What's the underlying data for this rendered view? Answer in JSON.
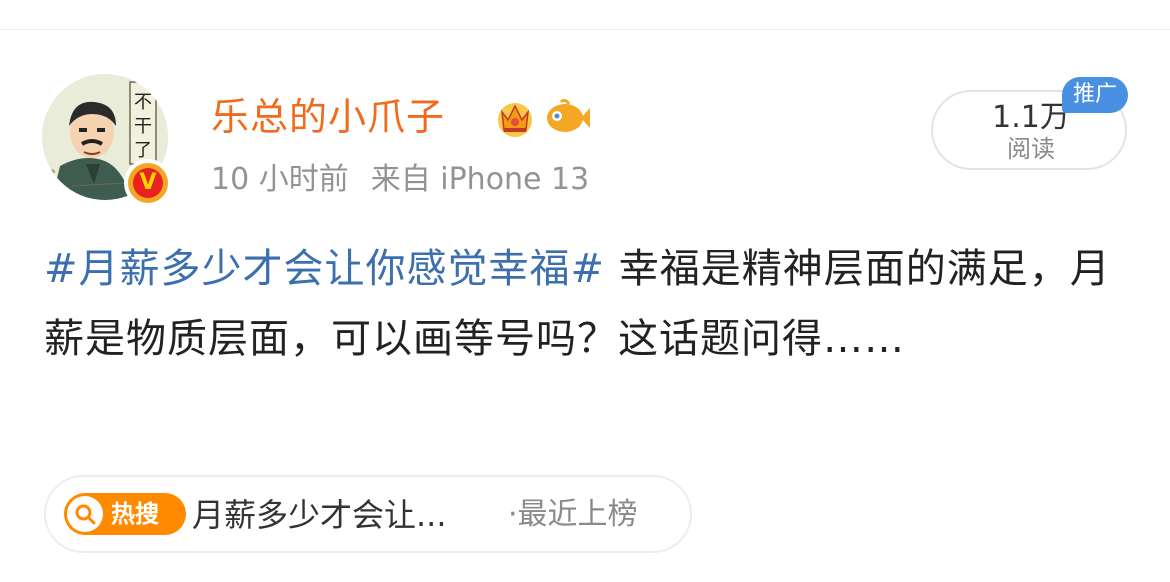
{
  "post": {
    "author": {
      "name": "乐总的小爪子",
      "avatar_icon": "cartoon-man-avatar",
      "verified_icon": "verified-v-badge",
      "badge_icons": [
        "crown-icon",
        "fish-icon"
      ]
    },
    "time": "10 小时前",
    "source": "来自 iPhone 13",
    "read_count": "1.1万",
    "read_label": "阅读",
    "promo_tag": "推广",
    "hashtag": "#月薪多少才会让你感觉幸福#",
    "text": "幸福是精神层面的满足，月薪是物质层面，可以画等号吗？这话题问得……"
  },
  "trending": {
    "badge": "热搜",
    "title": "月薪多少才会让...",
    "status": "·最近上榜"
  },
  "colors": {
    "username": "#f26b1d",
    "hashtag": "#3b6fae",
    "promo": "#4a90e2",
    "trend_badge": "#ff8a00"
  }
}
